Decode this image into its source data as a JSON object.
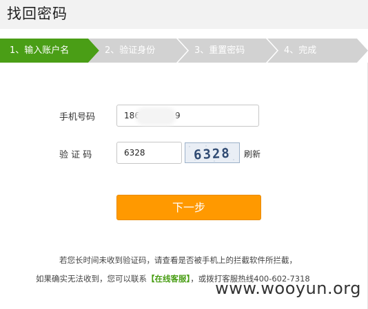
{
  "header": {
    "title": "找回密码"
  },
  "steps": [
    {
      "label": "1、输入账户名",
      "active": true
    },
    {
      "label": "2、验证身份",
      "active": false
    },
    {
      "label": "3、重置密码",
      "active": false
    },
    {
      "label": "4、完成",
      "active": false
    }
  ],
  "form": {
    "phone_label": "手机号码",
    "phone_value": "1861",
    "phone_tail": "9",
    "code_label": "验 证 码",
    "code_value": "6328",
    "captcha_text": "6328",
    "refresh_label": "刷新",
    "next_button": "下一步"
  },
  "help": {
    "line1": "若您长时间未收到验证码，请查看是否被手机上的拦截软件所拦截，",
    "line2_prefix": "如果确实无法收到，您可以联系",
    "support_link": "【在线客服】",
    "line2_suffix": "，或拨打客服热线400-602-7318"
  },
  "watermark": "www.wooyun.org",
  "colors": {
    "active_step": "#4a9e16",
    "inactive_step": "#d2d2d2",
    "primary_button": "#ff9900",
    "link": "#4a9e16"
  }
}
